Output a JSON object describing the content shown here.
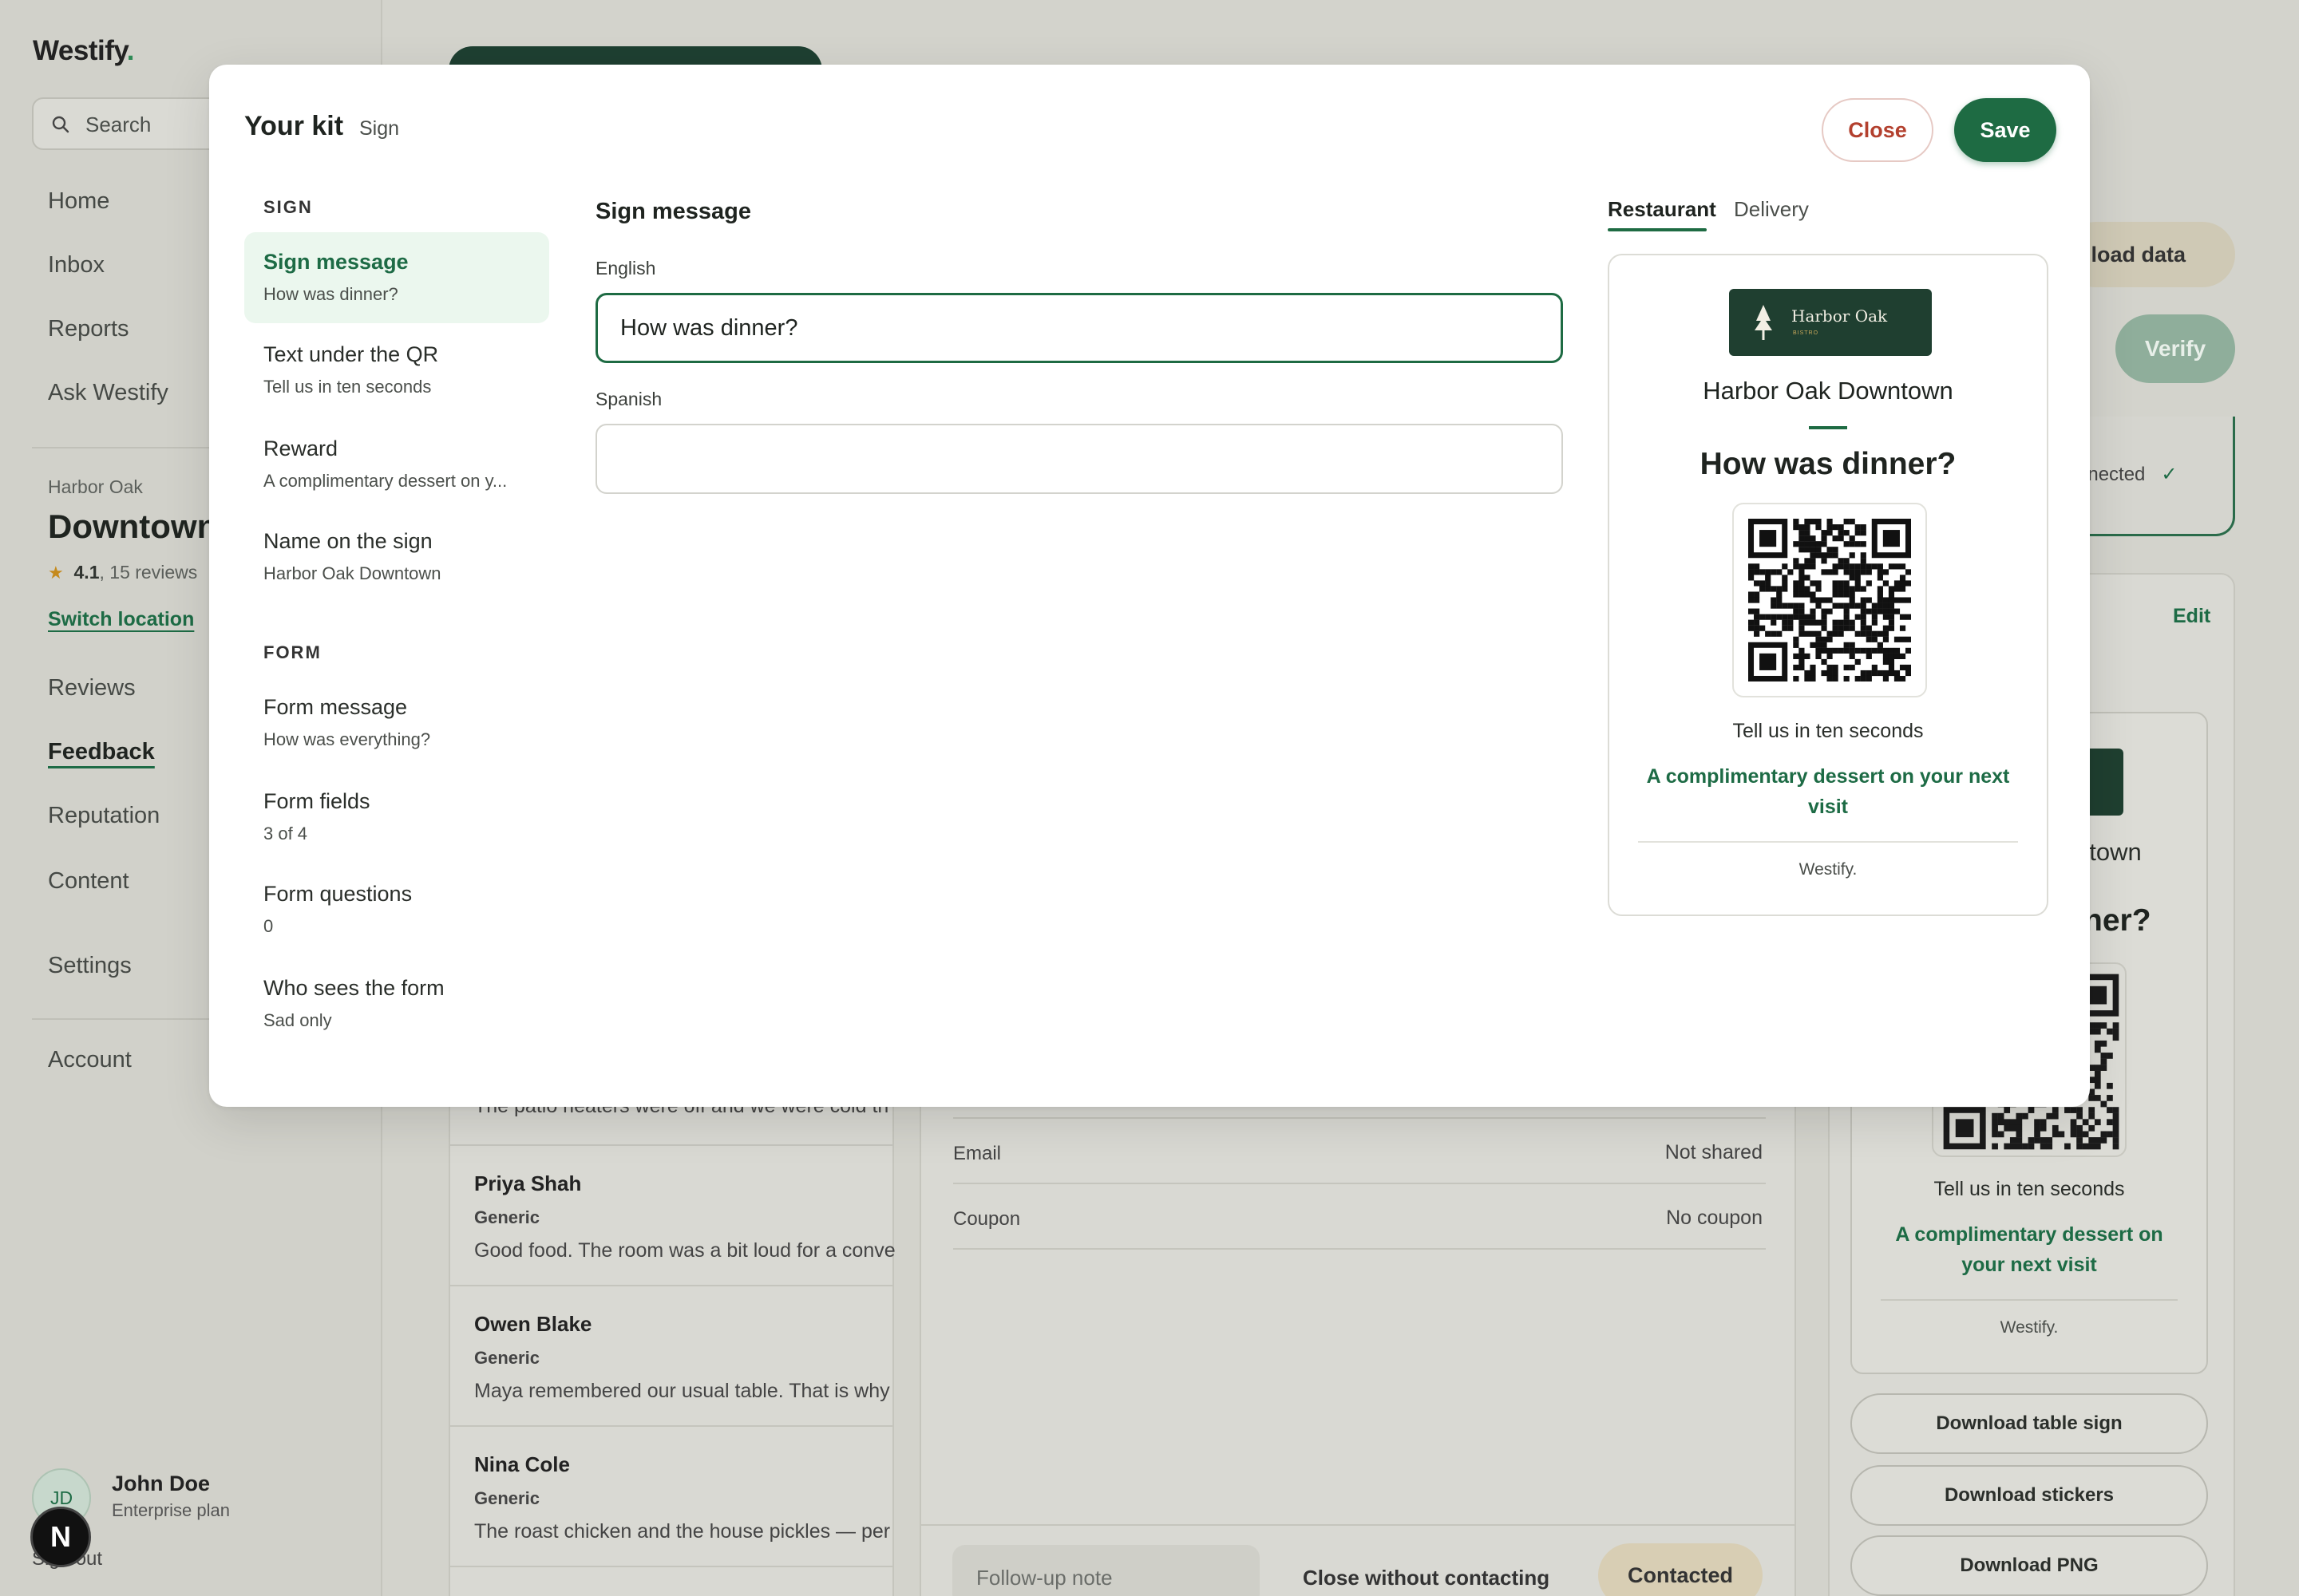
{
  "app": {
    "brand": "Westify",
    "brand_dot": ".",
    "search_placeholder": "Search",
    "nav": [
      "Home",
      "Inbox",
      "Reports",
      "Ask Westify"
    ],
    "location": {
      "group": "Harbor Oak",
      "name": "Downtown",
      "rating": "4.1",
      "reviews": ", 15 reviews",
      "switch_label": "Switch location"
    },
    "nav2": [
      "Reviews",
      "Feedback",
      "Reputation",
      "Content",
      "Settings"
    ],
    "nav_active": "Feedback",
    "account": "Account",
    "user": {
      "initials": "JD",
      "name": "John Doe",
      "plan": "Enterprise plan",
      "signout": "Sign out",
      "badge": "N"
    }
  },
  "background": {
    "feedback": [
      {
        "name": "",
        "tag": "",
        "text": "The patio heaters were off and we were cold th"
      },
      {
        "name": "Priya Shah",
        "tag": "Generic",
        "text": "Good food. The room was a bit loud for a conve"
      },
      {
        "name": "Owen Blake",
        "tag": "Generic",
        "text": "Maya remembered our usual table. That is why"
      },
      {
        "name": "Nina Cole",
        "tag": "Generic",
        "text": "The roast chicken and the house pickles — per"
      }
    ],
    "details": [
      {
        "label": "Email",
        "value": "Not shared"
      },
      {
        "label": "Coupon",
        "value": "No coupon"
      }
    ],
    "followup_placeholder": "Follow-up note",
    "close_without": "Close without contacting",
    "contacted": "Contacted",
    "download_data": "nload data",
    "verify": "Verify",
    "connected": "nnected",
    "connected_check": "✓",
    "edit": "Edit",
    "mini_sign": {
      "name": "ntown",
      "msg": "ner?",
      "under": "Tell us in ten seconds",
      "reward": "A complimentary dessert on your next visit",
      "brand": "Westify."
    },
    "downloads": [
      "Download table sign",
      "Download stickers",
      "Download PNG"
    ]
  },
  "modal": {
    "title": "Your kit",
    "subtitle": "Sign",
    "close": "Close",
    "save": "Save",
    "sections": [
      {
        "heading": "SIGN",
        "items": [
          {
            "title": "Sign message",
            "sub": "How was dinner?",
            "active": true
          },
          {
            "title": "Text under the QR",
            "sub": "Tell us in ten seconds"
          },
          {
            "title": "Reward",
            "sub": "A complimentary dessert on y..."
          },
          {
            "title": "Name on the sign",
            "sub": "Harbor Oak Downtown"
          }
        ]
      },
      {
        "heading": "FORM",
        "items": [
          {
            "title": "Form message",
            "sub": "How was everything?"
          },
          {
            "title": "Form fields",
            "sub": "3 of 4"
          },
          {
            "title": "Form questions",
            "sub": "0"
          },
          {
            "title": "Who sees the form",
            "sub": "Sad only"
          }
        ]
      }
    ],
    "editor": {
      "title": "Sign message",
      "english_label": "English",
      "english_value": "How was dinner?",
      "spanish_label": "Spanish",
      "spanish_value": ""
    },
    "tabs": [
      "Restaurant",
      "Delivery"
    ],
    "active_tab": "Restaurant",
    "preview": {
      "logo_name": "Harbor Oak",
      "logo_sub": "BISTRO",
      "location_name": "Harbor Oak Downtown",
      "message": "How was dinner?",
      "under_qr": "Tell us in ten seconds",
      "reward": "A complimentary dessert on your next visit",
      "brand": "Westify."
    },
    "colors": {
      "accent": "#1e6b43",
      "close_text": "#b3402e",
      "active_bg": "#ebf7ee",
      "logo_bg": "#1f3f30"
    }
  }
}
